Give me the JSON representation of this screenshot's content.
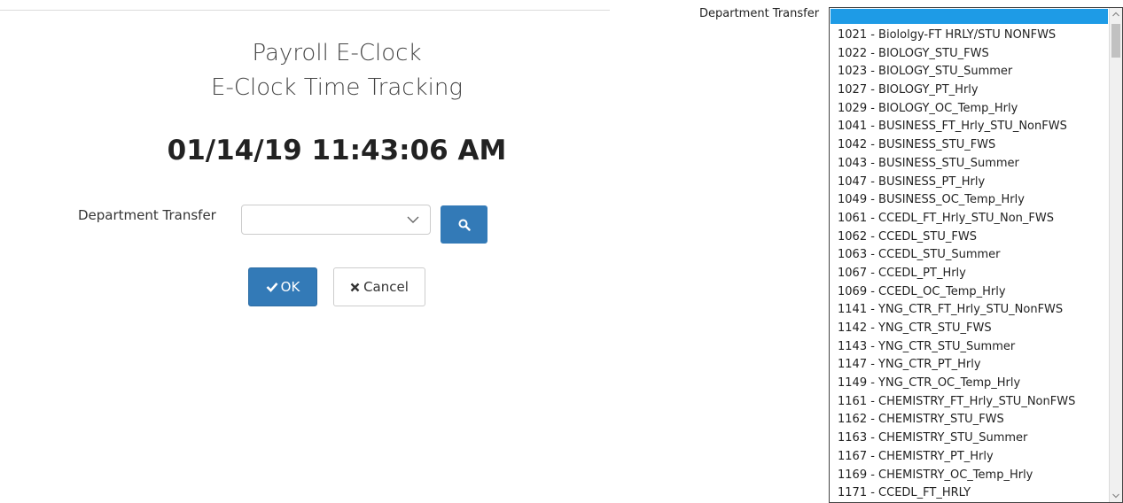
{
  "page": {
    "title_line1": "Payroll E-Clock",
    "title_line2": "E-Clock Time Tracking",
    "clock": "01/14/19 11:43:06 AM"
  },
  "form": {
    "department_label": "Department Transfer",
    "department_value": "",
    "ok_label": "OK",
    "cancel_label": "Cancel"
  },
  "dropdown": {
    "label": "Department Transfer",
    "selected": "",
    "options": [
      "1021 - Biololgy-FT HRLY/STU NONFWS",
      "1022 - BIOLOGY_STU_FWS",
      "1023 - BIOLOGY_STU_Summer",
      "1027 - BIOLOGY_PT_Hrly",
      "1029 - BIOLOGY_OC_Temp_Hrly",
      "1041 - BUSINESS_FT_Hrly_STU_NonFWS",
      "1042 - BUSINESS_STU_FWS",
      "1043 - BUSINESS_STU_Summer",
      "1047 - BUSINESS_PT_Hrly",
      "1049 - BUSINESS_OC_Temp_Hrly",
      "1061 - CCEDL_FT_Hrly_STU_Non_FWS",
      "1062 - CCEDL_STU_FWS",
      "1063 - CCEDL_STU_Summer",
      "1067 - CCEDL_PT_Hrly",
      "1069 - CCEDL_OC_Temp_Hrly",
      "1141 - YNG_CTR_FT_Hrly_STU_NonFWS",
      "1142 - YNG_CTR_STU_FWS",
      "1143 - YNG_CTR_STU_Summer",
      "1147 - YNG_CTR_PT_Hrly",
      "1149 - YNG_CTR_OC_Temp_Hrly",
      "1161 - CHEMISTRY_FT_Hrly_STU_NonFWS",
      "1162 - CHEMISTRY_STU_FWS",
      "1163 - CHEMISTRY_STU_Summer",
      "1167 - CHEMISTRY_PT_Hrly",
      "1169 - CHEMISTRY_OC_Temp_Hrly",
      "1171 - CCEDL_FT_HRLY"
    ]
  },
  "colors": {
    "primary": "#337ab7",
    "selection": "#1e9be6"
  }
}
